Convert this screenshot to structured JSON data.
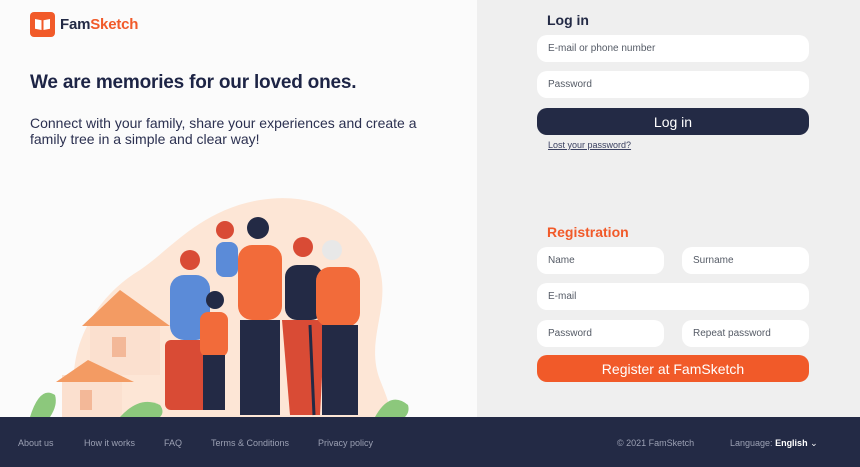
{
  "brand": {
    "name_part1": "Fam",
    "name_part2": "Sketch"
  },
  "hero": {
    "headline": "We are memories for our loved ones.",
    "subtext": "Connect with your family, share your experiences and create a family tree in a simple and clear way!"
  },
  "login": {
    "title": "Log in",
    "email_placeholder": "E-mail or phone number",
    "password_placeholder": "Password",
    "button_label": "Log in",
    "lost_password": "Lost your password?"
  },
  "registration": {
    "title": "Registration",
    "name_placeholder": "Name",
    "surname_placeholder": "Surname",
    "email_placeholder": "E-mail",
    "password_placeholder": "Password",
    "repeat_password_placeholder": "Repeat password",
    "button_label": "Register at FamSketch"
  },
  "footer": {
    "links": [
      "About us",
      "How it works",
      "FAQ",
      "Terms & Conditions",
      "Privacy policy"
    ],
    "copyright": "© 2021 FamSketch",
    "language_label": "Language:",
    "language_value": "English"
  },
  "colors": {
    "navy": "#232a45",
    "orange": "#f15a29",
    "panel": "#efefef"
  }
}
